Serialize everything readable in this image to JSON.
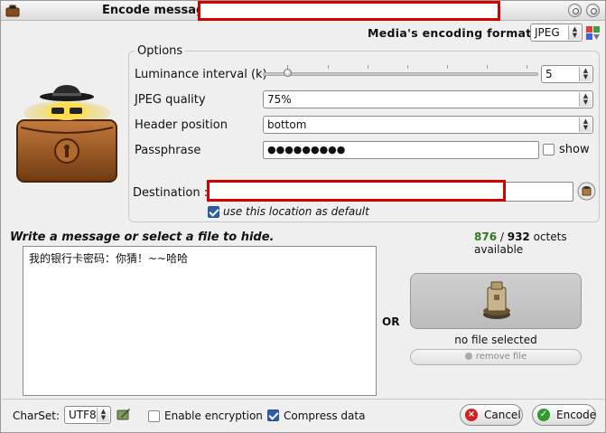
{
  "window": {
    "title": "Encode message"
  },
  "encoding": {
    "label": "Media's encoding format :",
    "format": "JPEG"
  },
  "options": {
    "legend": "Options",
    "luminance_label": "Luminance interval (k)",
    "luminance_value": "5",
    "slider_fraction": 0.1,
    "jpeg_quality_label": "JPEG quality",
    "jpeg_quality_value": "75%",
    "header_position_label": "Header position",
    "header_position_value": "bottom",
    "passphrase_label": "Passphrase",
    "passphrase_value": "●●●●●●●●●",
    "show_label": "show",
    "destination_label": "Destination :",
    "use_default_label": "use this location as default"
  },
  "message": {
    "heading": "Write a message or select a file to hide.",
    "octets_used": "876",
    "octets_total": "932",
    "octets_sep": " / ",
    "octets_suffix": " octets available",
    "text": "我的银行卡密码：你猜！~~哈哈"
  },
  "file": {
    "or_label": "OR",
    "status": "no file selected",
    "remove_label": "remove file"
  },
  "bottom": {
    "charset_label": "CharSet:",
    "charset_value": "UTF8",
    "encryption_label": "Enable encryption",
    "compress_label": "Compress data",
    "cancel_label": "Cancel",
    "encode_label": "Encode"
  },
  "colors": {
    "redaction": "#d40000",
    "octets_used": "#2d7a1d",
    "cancel_icon": "#d02020",
    "encode_icon": "#2f9a2f"
  }
}
